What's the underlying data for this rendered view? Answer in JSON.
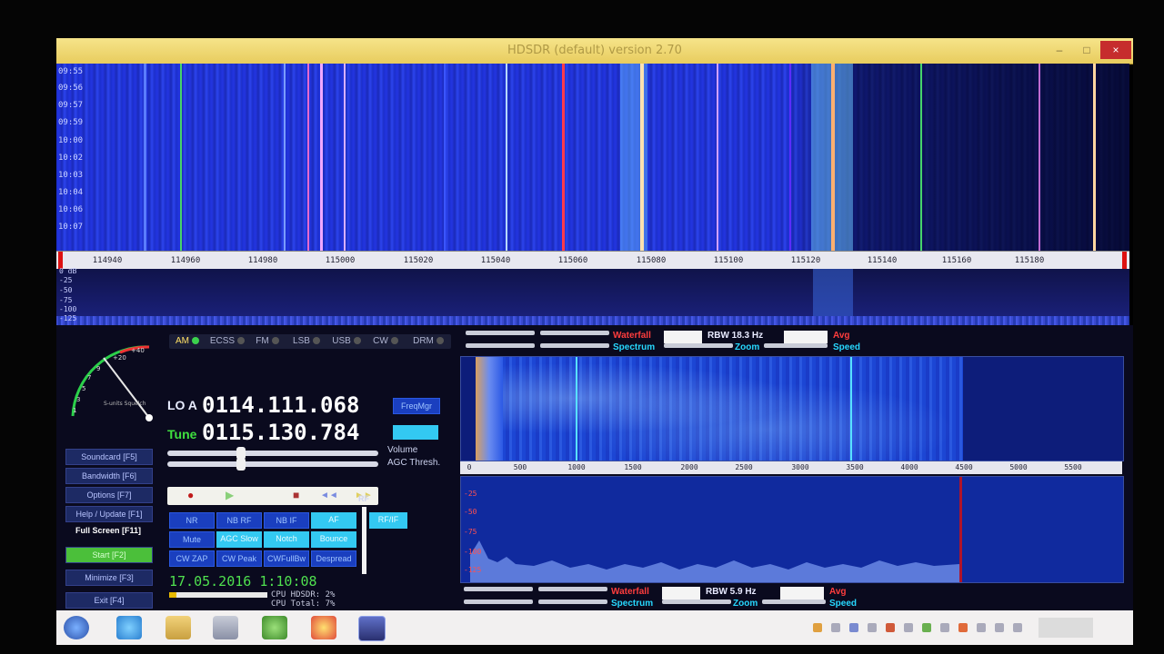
{
  "window": {
    "title": "HDSDR (default)  version 2.70",
    "controls": {
      "minimize": "–",
      "maximize": "□",
      "close": "×"
    }
  },
  "waterfall": {
    "timestamps": [
      "09:55",
      "09:56",
      "09:57",
      "09:59",
      "10:00",
      "10:02",
      "10:03",
      "10:04",
      "10:06",
      "10:07"
    ],
    "freq_ticks": [
      "114940",
      "114960",
      "114980",
      "115000",
      "115020",
      "115040",
      "115060",
      "115080",
      "115100",
      "115120",
      "115140",
      "115160",
      "115180"
    ]
  },
  "spectrum": {
    "db_labels": [
      "0 dB",
      "-25",
      "-50",
      "-75",
      "-100",
      "-125"
    ]
  },
  "modes": [
    {
      "label": "AM",
      "active": true
    },
    {
      "label": "ECSS",
      "active": false
    },
    {
      "label": "FM",
      "active": false
    },
    {
      "label": "LSB",
      "active": false
    },
    {
      "label": "USB",
      "active": false
    },
    {
      "label": "CW",
      "active": false
    },
    {
      "label": "DRM",
      "active": false
    }
  ],
  "smeter": {
    "scale": [
      "+40",
      "+20",
      "9",
      "7",
      "5",
      "3",
      "1"
    ],
    "label": "S-units Squelch"
  },
  "lo": {
    "label": "LO A",
    "value": "0114.111.068",
    "button": "FreqMgr"
  },
  "tune": {
    "label": "Tune",
    "value": "0115.130.784"
  },
  "sliders": {
    "volume": "Volume",
    "agc": "AGC Thresh."
  },
  "transport": {
    "record": "●",
    "play": "▶",
    "stop": "■",
    "rewind": "◄◄",
    "forward": "►►"
  },
  "sidebar": [
    {
      "label": "Soundcard [F5]",
      "style": "normal"
    },
    {
      "label": "Bandwidth [F6]",
      "style": "normal"
    },
    {
      "label": "Options   [F7]",
      "style": "normal"
    },
    {
      "label": "Help / Update [F1]",
      "style": "normal"
    },
    {
      "label": "Full Screen [F11]",
      "style": "plain"
    },
    {
      "label": "Start    [F2]",
      "style": "green"
    },
    {
      "label": "Minimize [F3]",
      "style": "normal"
    },
    {
      "label": "Exit     [F4]",
      "style": "normal"
    }
  ],
  "nr_buttons": [
    [
      "NR",
      "NB RF",
      "NB IF",
      "AF"
    ],
    [
      "Mute",
      "AGC Slow",
      "Notch",
      "Bounce"
    ],
    [
      "CW ZAP",
      "CW Peak",
      "CWFullBw",
      "Despread"
    ]
  ],
  "extra_buttons": {
    "preset": "RF/IF"
  },
  "rf_label": "RF",
  "status": {
    "datetime": "17.05.2016 1:10:08",
    "cpu_hdsdr": "CPU HDSDR:  2%",
    "cpu_total": "CPU Total:  7%"
  },
  "af_top_controls": {
    "waterfall": "Waterfall",
    "spectrum": "Spectrum",
    "rbw": "RBW 18.3 Hz",
    "zoom": "Zoom",
    "avg": "Avg",
    "speed": "Speed"
  },
  "af_bottom_controls": {
    "waterfall": "Waterfall",
    "spectrum": "Spectrum",
    "rbw": "RBW 5.9 Hz",
    "zoom": "Zoom",
    "avg": "Avg",
    "speed": "Speed"
  },
  "af_ruler": [
    "0",
    "500",
    "1000",
    "1500",
    "2000",
    "2500",
    "3000",
    "3500",
    "4000",
    "4500",
    "5000",
    "5500"
  ],
  "af_spectrum_db": [
    "-25",
    "-50",
    "-75",
    "-100",
    "-125"
  ],
  "colors": {
    "accent_cyan": "#33c9f2",
    "waterfall_blue": "#2435e0",
    "title_yellow": "#f0d970"
  }
}
